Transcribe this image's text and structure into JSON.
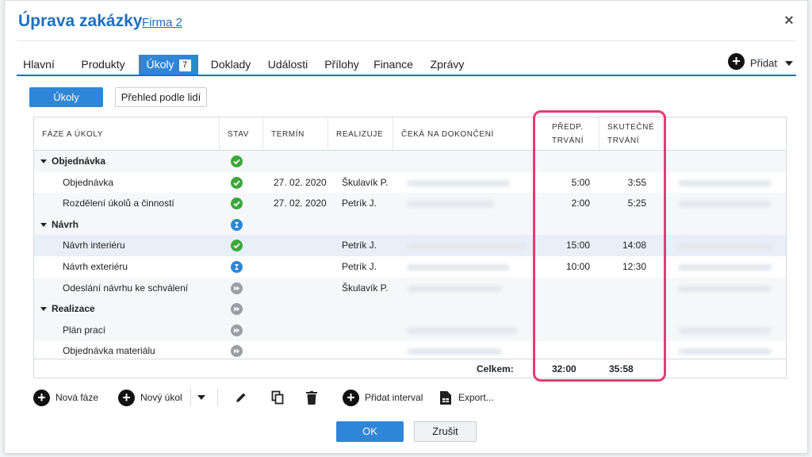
{
  "header": {
    "title": "Úprava zakázky",
    "company_link": "Firma 2",
    "close_label": "×"
  },
  "tabs": [
    {
      "label": "Hlavní"
    },
    {
      "label": "Produkty"
    },
    {
      "label": "Úkoly",
      "badge": "7",
      "active": true
    },
    {
      "label": "Doklady"
    },
    {
      "label": "Události"
    },
    {
      "label": "Přílohy"
    },
    {
      "label": "Finance"
    },
    {
      "label": "Zprávy"
    }
  ],
  "add_menu": {
    "label": "Přidat"
  },
  "subtabs": {
    "tasks": "Úkoly",
    "overview": "Přehled podle lidí"
  },
  "columns": {
    "phase": "FÁZE A ÚKOLY",
    "status": "STAV",
    "deadline": "TERMÍN",
    "assignee": "REALIZUJE",
    "waiting": "ČEKÁ NA DOKONČENÍ",
    "planned_line1": "PŘEDP.",
    "planned_line2": "TRVÁNÍ",
    "actual_line1": "SKUTEČNÉ",
    "actual_line2": "TRVÁNÍ"
  },
  "rows": [
    {
      "type": "group",
      "name": "Objednávka",
      "status": "done",
      "deadline": "",
      "assignee": "",
      "planned": "",
      "actual": ""
    },
    {
      "type": "task",
      "name": "Objednávka",
      "status": "done",
      "deadline": "27. 02. 2020",
      "assignee": "Škulavík P.",
      "planned": "5:00",
      "actual": "3:55"
    },
    {
      "type": "task",
      "name": "Rozdělení úkolů a činností",
      "status": "done",
      "deadline": "27. 02. 2020",
      "assignee": "Petrík J.",
      "planned": "2:00",
      "actual": "5:25"
    },
    {
      "type": "group",
      "name": "Návrh",
      "status": "inprogress",
      "deadline": "",
      "assignee": "",
      "planned": "",
      "actual": ""
    },
    {
      "type": "task",
      "name": "Návrh interiéru",
      "status": "done",
      "deadline": "",
      "assignee": "Petrík J.",
      "planned": "15:00",
      "actual": "14:08"
    },
    {
      "type": "task",
      "name": "Návrh exteriéru",
      "status": "inprogress",
      "deadline": "",
      "assignee": "Petrík J.",
      "planned": "10:00",
      "actual": "12:30"
    },
    {
      "type": "task",
      "name": "Odeslání návrhu ke schválení",
      "status": "waiting",
      "deadline": "",
      "assignee": "Škulavík P.",
      "planned": "",
      "actual": ""
    },
    {
      "type": "group",
      "name": "Realizace",
      "status": "waiting",
      "deadline": "",
      "assignee": "",
      "planned": "",
      "actual": ""
    },
    {
      "type": "task",
      "name": "Plán prací",
      "status": "waiting",
      "deadline": "",
      "assignee": "",
      "planned": "",
      "actual": ""
    },
    {
      "type": "task",
      "name": "Objednávka materiálu",
      "status": "waiting",
      "deadline": "",
      "assignee": "",
      "planned": "",
      "actual": ""
    }
  ],
  "totals": {
    "label": "Celkem:",
    "planned": "32:00",
    "actual": "35:58"
  },
  "toolbar": {
    "new_phase": "Nová fáze",
    "new_task": "Nový úkol",
    "add_interval": "Přidat interval",
    "export": "Export..."
  },
  "footer": {
    "ok": "OK",
    "cancel": "Zrušit"
  },
  "colors": {
    "accent": "#2f86d8",
    "title": "#1e6fc0",
    "done": "#3ca63c",
    "inprogress": "#2f86d8",
    "waiting": "#9a9ea4",
    "highlight": "#e43c74"
  }
}
